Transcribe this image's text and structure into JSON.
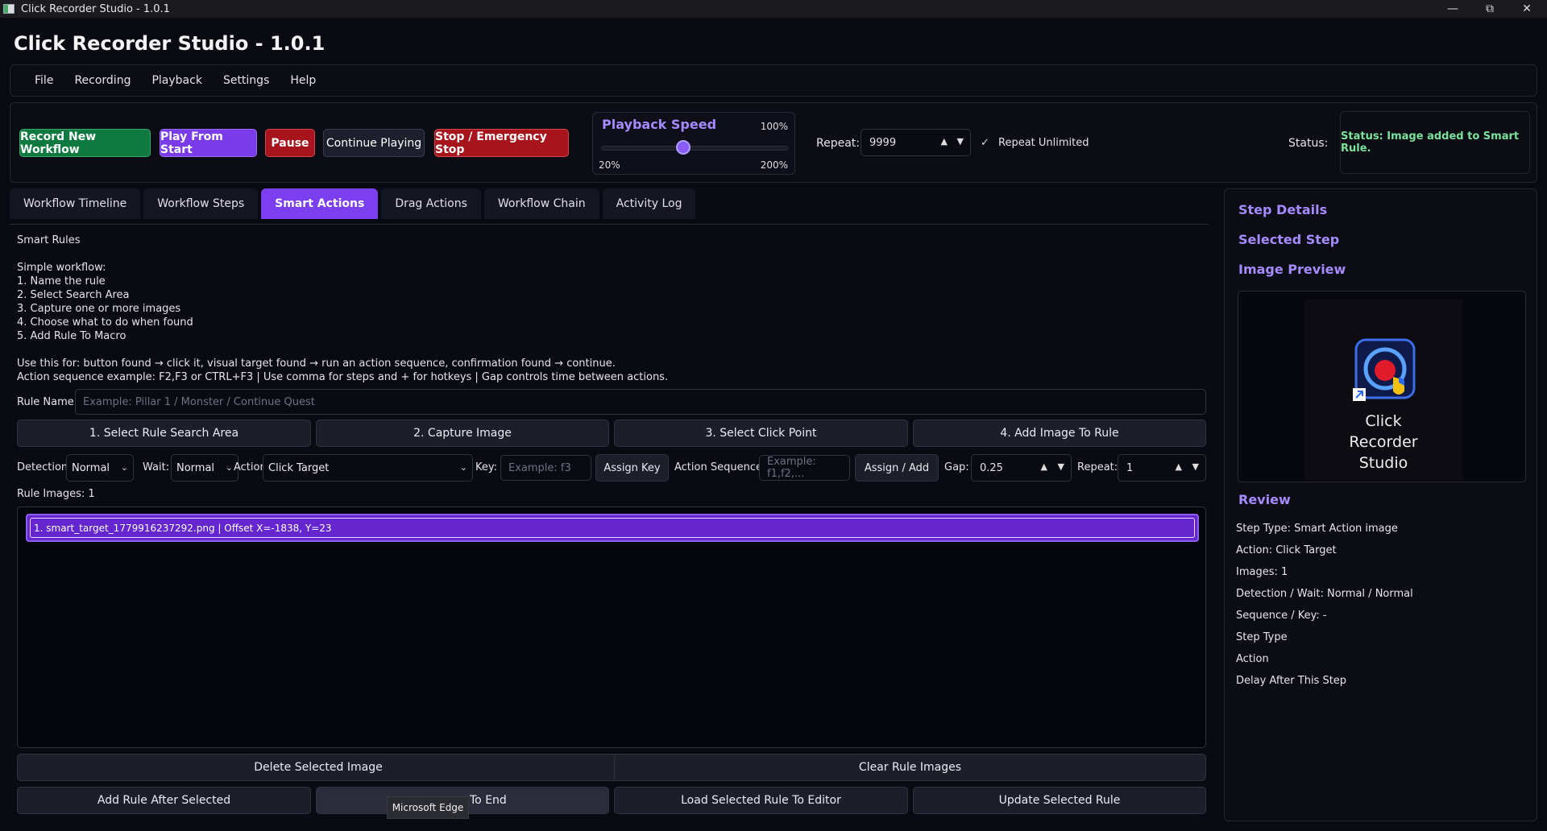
{
  "window": {
    "title": "Click Recorder Studio - 1.0.1"
  },
  "app_title": "Click Recorder Studio - 1.0.1",
  "menu": [
    "File",
    "Recording",
    "Playback",
    "Settings",
    "Help"
  ],
  "toolbar": {
    "record": "Record New Workflow",
    "play": "Play From Start",
    "pause": "Pause",
    "continue": "Continue Playing",
    "stop": "Stop / Emergency Stop",
    "speed_label": "Playback Speed",
    "speed_value": "100%",
    "speed_min": "20%",
    "speed_max": "200%",
    "speed_level": 0.44,
    "repeat_label": "Repeat:",
    "repeat_value": "9999",
    "repeat_unlimited": "Repeat Unlimited",
    "repeat_unlimited_checked": true,
    "status_label": "Status:",
    "status_text": "Status: Image added to Smart Rule."
  },
  "tabs": [
    "Workflow Timeline",
    "Workflow Steps",
    "Smart Actions",
    "Drag Actions",
    "Workflow Chain",
    "Activity Log"
  ],
  "active_tab": "Smart Actions",
  "smart": {
    "heading": "Smart Rules",
    "instructions": "Simple workflow:\n1. Name the rule\n2. Select Search Area\n3. Capture one or more images\n4. Choose what to do when found\n5. Add Rule To Macro",
    "usage": "Use this for: button found → click it, visual target found → run an action sequence, confirmation found → continue.\nAction sequence example: F2,F3 or CTRL+F3 | Use comma for steps and + for hotkeys | Gap controls time between actions.",
    "rule_name_label": "Rule Name:",
    "rule_name_placeholder": "Example: Pillar 1 / Monster / Continue Quest",
    "steps": [
      "1. Select Rule Search Area",
      "2. Capture Image",
      "3. Select Click Point",
      "4. Add Image To Rule"
    ],
    "detection_label": "Detection:",
    "detection_value": "Normal",
    "wait_label": "Wait:",
    "wait_value": "Normal",
    "action_label": "Action:",
    "action_value": "Click Target",
    "key_label": "Key:",
    "key_placeholder": "Example: f3",
    "assign_key": "Assign Key",
    "sequence_label": "Action Sequence:",
    "sequence_placeholder": "Example: f1,f2,...",
    "assign_add": "Assign / Add",
    "gap_label": "Gap:",
    "gap_value": "0.25",
    "repeat_label": "Repeat:",
    "repeat_value": "1",
    "images_count": "Rule Images: 1",
    "images": [
      "1. smart_target_1779916237292.png | Offset X=-1838, Y=23"
    ],
    "delete_image": "Delete Selected Image",
    "clear_images": "Clear Rule Images",
    "add_after": "Add Rule After Selected",
    "add_end": "To End",
    "load_rule": "Load Selected Rule To Editor",
    "update_rule": "Update Selected Rule"
  },
  "tooltip": "Microsoft Edge",
  "right": {
    "step_details": "Step Details",
    "selected_step": "Selected Step",
    "image_preview": "Image Preview",
    "preview_caption": [
      "Click",
      "Recorder",
      "Studio"
    ],
    "review": "Review",
    "review_lines": [
      "Step Type: Smart Action image",
      "Action: Click Target",
      "Images: 1",
      "Detection / Wait: Normal / Normal",
      "Sequence / Key: -",
      "Step Type",
      "Action",
      "Delay After This Step"
    ]
  }
}
